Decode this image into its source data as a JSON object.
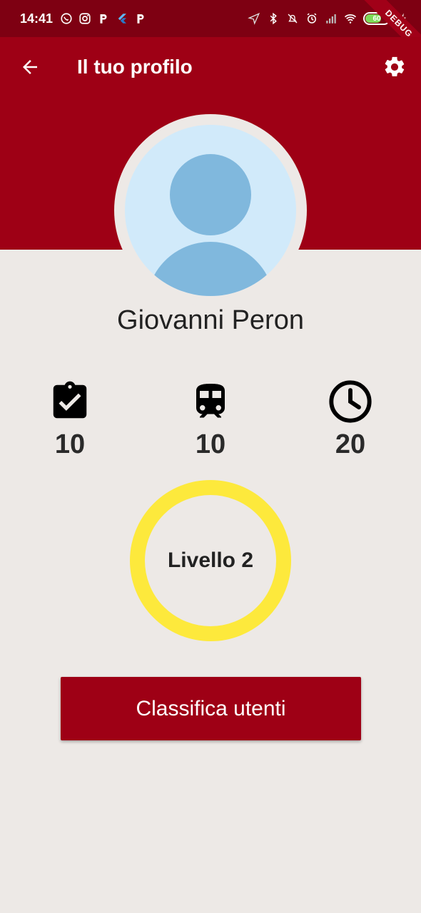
{
  "status_bar": {
    "time": "14:41",
    "battery": "60",
    "icons_left": [
      "whatsapp-icon",
      "instagram-icon",
      "p-app-icon",
      "flutter-icon",
      "p-app-icon"
    ],
    "icons_right": [
      "location-icon",
      "bluetooth-icon",
      "mute-icon",
      "alarm-icon",
      "signal-icon",
      "wifi-icon",
      "battery-icon",
      "charging-icon"
    ]
  },
  "debug_banner": "DEBUG",
  "app_bar": {
    "title": "Il tuo profilo",
    "back_icon": "arrow-back-icon",
    "settings_icon": "gear-icon",
    "background": "#9e0015"
  },
  "profile": {
    "name": "Giovanni Peron"
  },
  "stats": {
    "tasks": {
      "icon": "clipboard-check-icon",
      "value": "10"
    },
    "trains": {
      "icon": "train-icon",
      "value": "10"
    },
    "time": {
      "icon": "clock-icon",
      "value": "20"
    }
  },
  "level": {
    "label": "Livello 2",
    "ring_color": "#fde93c"
  },
  "ranking_button": {
    "label": "Classifica utenti"
  },
  "colors": {
    "primary": "#9e0015",
    "status_bar": "#7e0012",
    "background": "#ede9e6",
    "avatar_bg": "#d1eafa",
    "avatar_fg": "#80b8dd"
  }
}
